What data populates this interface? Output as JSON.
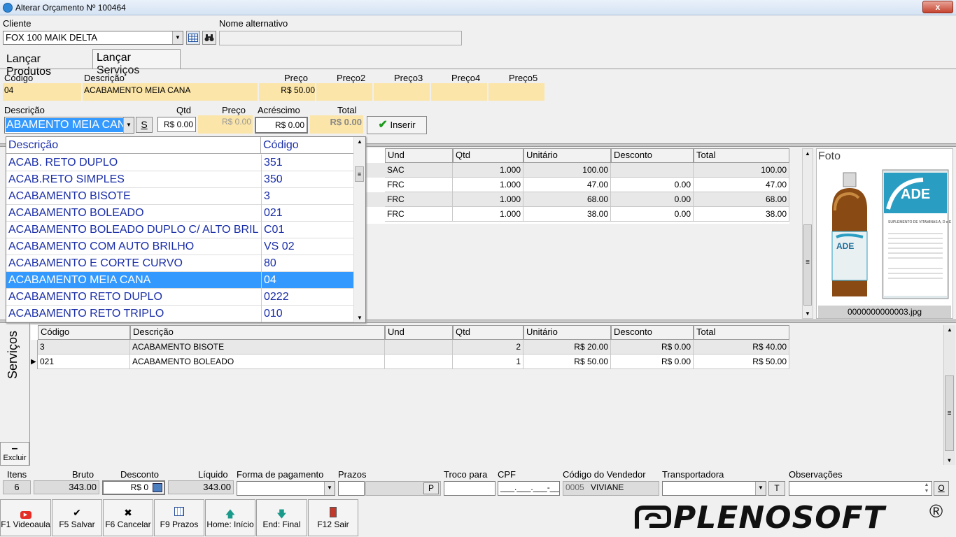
{
  "window": {
    "title": "Alterar Orçamento Nº 100464",
    "close": "x"
  },
  "cliente": {
    "label": "Cliente",
    "value": "FOX 100 MAIK DELTA"
  },
  "nome_alt": {
    "label": "Nome alternativo",
    "value": ""
  },
  "tabs": [
    {
      "label": "Lançar Produtos"
    },
    {
      "label": "Lançar Serviços"
    }
  ],
  "product_row": {
    "headers": {
      "codigo": "Código",
      "descricao": "Descrição",
      "preco": "Preço",
      "preco2": "Preço2",
      "preco3": "Preço3",
      "preco4": "Preço4",
      "preco5": "Preço5"
    },
    "values": {
      "codigo": "04",
      "descricao": "ACABAMENTO MEIA CANA",
      "preco": "R$ 50.00"
    }
  },
  "entry": {
    "descricao_label": "Descrição",
    "descricao_value": "ABAMENTO MEIA CAN",
    "s_button": "S",
    "qtd_label": "Qtd",
    "qtd_value": "R$ 0.00",
    "preco_label": "Preço",
    "preco_value": "R$ 0.00",
    "acrescimo_label": "Acréscimo",
    "acrescimo_value": "R$ 0.00",
    "total_label": "Total",
    "total_value": "R$ 0.00",
    "inserir": "Inserir"
  },
  "dropdown": {
    "headers": {
      "descricao": "Descrição",
      "codigo": "Código"
    },
    "rows": [
      {
        "d": "ACAB. RETO DUPLO",
        "c": "351"
      },
      {
        "d": "ACAB.RETO SIMPLES",
        "c": "350"
      },
      {
        "d": "ACABAMENTO BISOTE",
        "c": "3"
      },
      {
        "d": "ACABAMENTO BOLEADO",
        "c": "021"
      },
      {
        "d": "ACABAMENTO BOLEADO DUPLO C/ ALTO BRILHO",
        "c": "C01"
      },
      {
        "d": "ACABAMENTO COM AUTO BRILHO",
        "c": "VS 02"
      },
      {
        "d": "ACABAMENTO E CORTE CURVO",
        "c": "80"
      },
      {
        "d": "ACABAMENTO MEIA CANA",
        "c": "04"
      },
      {
        "d": "ACABAMENTO RETO DUPLO",
        "c": "0222"
      },
      {
        "d": "ACABAMENTO RETO TRIPLO",
        "c": "010"
      }
    ]
  },
  "products_grid": {
    "headers": {
      "und": "Und",
      "qtd": "Qtd",
      "unitario": "Unitário",
      "desconto": "Desconto",
      "total": "Total"
    },
    "rows": [
      {
        "und": "SAC",
        "qtd": "1.000",
        "unitario": "100.00",
        "desconto": "",
        "total": "100.00"
      },
      {
        "und": "FRC",
        "qtd": "1.000",
        "unitario": "47.00",
        "desconto": "0.00",
        "total": "47.00"
      },
      {
        "und": "FRC",
        "qtd": "1.000",
        "unitario": "68.00",
        "desconto": "0.00",
        "total": "68.00"
      },
      {
        "und": "FRC",
        "qtd": "1.000",
        "unitario": "38.00",
        "desconto": "0.00",
        "total": "38.00"
      }
    ]
  },
  "foto": {
    "label": "Foto",
    "filename": "0000000000003.jpg",
    "box_label": "ADE",
    "bottle_label": "ADE",
    "box_subtitle": "SUPLEMENTO DE VITAMINAS A, D e E"
  },
  "services": {
    "side_label": "Serviços",
    "excluir": "Excluir",
    "headers": {
      "codigo": "Código",
      "descricao": "Descrição",
      "und": "Und",
      "qtd": "Qtd",
      "unitario": "Unitário",
      "desconto": "Desconto",
      "total": "Total"
    },
    "rows": [
      {
        "codigo": "3",
        "descricao": "ACABAMENTO BISOTE",
        "und": "",
        "qtd": "2",
        "unitario": "R$ 20.00",
        "desconto": "R$ 0.00",
        "total": "R$ 40.00"
      },
      {
        "codigo": "021",
        "descricao": "ACABAMENTO BOLEADO",
        "und": "",
        "qtd": "1",
        "unitario": "R$ 50.00",
        "desconto": "R$ 0.00",
        "total": "R$ 50.00"
      }
    ]
  },
  "footer": {
    "itens_label": "Itens",
    "itens": "6",
    "bruto_label": "Bruto",
    "bruto": "343.00",
    "desconto_label": "Desconto",
    "desconto": "R$ 0",
    "liquido_label": "Líquido",
    "liquido": "343.00",
    "forma_label": "Forma de pagamento",
    "forma": "",
    "prazos_label": "Prazos",
    "prazos_btn": "P",
    "troco_label": "Troco para",
    "cpf_label": "CPF",
    "cpf": "___.___.___-__",
    "vendedor_label": "Código do Vendedor",
    "vendedor_code": "0005",
    "vendedor_name": "VIVIANE",
    "transp_label": "Transportadora",
    "transp_btn": "T",
    "obs_label": "Observações",
    "obs_btn": "O"
  },
  "fkeys": [
    {
      "label": "F1 Videoaula",
      "icon": "youtube-icon"
    },
    {
      "label": "F5 Salvar",
      "icon": "check-icon"
    },
    {
      "label": "F6 Cancelar",
      "icon": "x-icon"
    },
    {
      "label": "F9 Prazos",
      "icon": "calendar-icon"
    },
    {
      "label": "Home: Início",
      "icon": "arrow-up-icon"
    },
    {
      "label": "End: Final",
      "icon": "arrow-down-icon"
    },
    {
      "label": "F12 Sair",
      "icon": "exit-icon"
    }
  ],
  "brand": {
    "name": "PLENOSOFT",
    "reg": "®"
  }
}
